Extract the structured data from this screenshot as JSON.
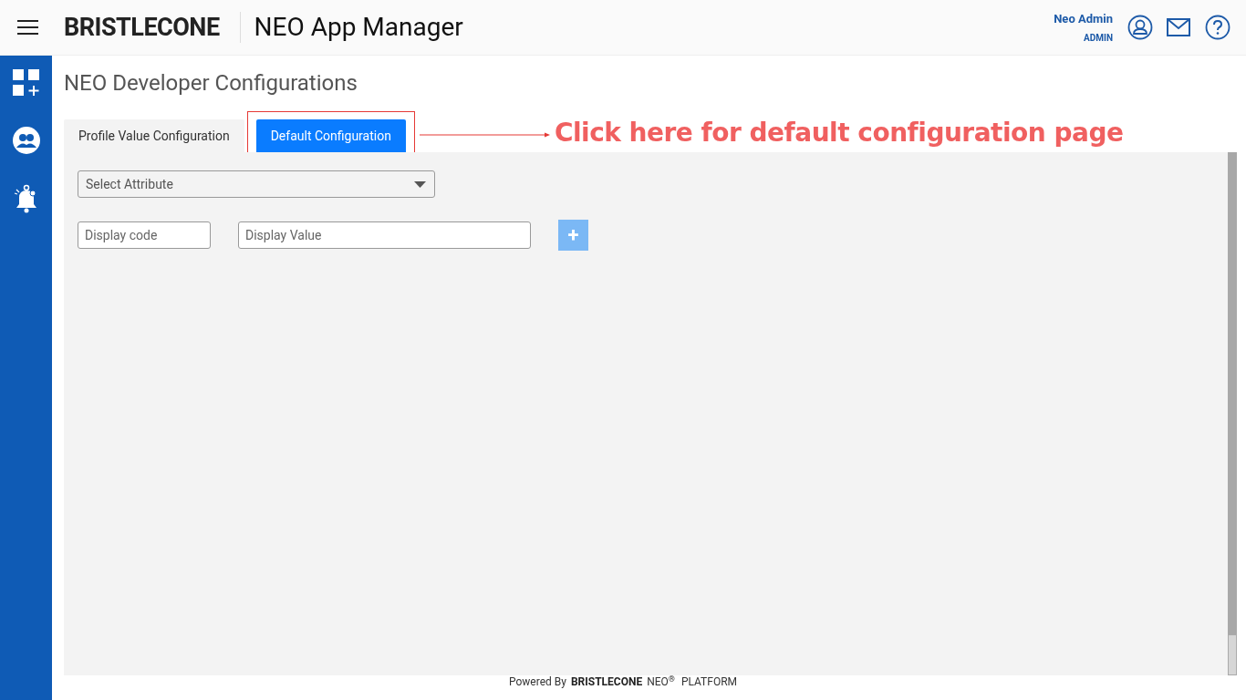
{
  "header": {
    "logo": "BRISTLECONE",
    "app_title": "NEO App Manager",
    "user": {
      "name": "Neo Admin",
      "role": "ADMIN"
    }
  },
  "sidebar": {
    "items": [
      {
        "kind": "apps"
      },
      {
        "kind": "users"
      },
      {
        "kind": "alerts"
      }
    ]
  },
  "page": {
    "title": "NEO Developer Configurations",
    "tabs": [
      {
        "label": "Profile Value Configuration",
        "selected": false,
        "highlighted": false
      },
      {
        "label": "Default Configuration",
        "selected": true,
        "highlighted": true
      }
    ],
    "annotation": {
      "text": "Click here for default configuration page"
    },
    "form": {
      "attribute_select": {
        "placeholder": "Select Attribute"
      },
      "display_code": {
        "placeholder": "Display code"
      },
      "display_value": {
        "placeholder": "Display Value"
      },
      "add_button": {
        "label": "+",
        "disabled": true
      }
    }
  },
  "footer": {
    "prefix": "Powered By",
    "brand": "BRISTLECONE",
    "product": "NEO$^{®}$",
    "suffix": "PLATFORM"
  }
}
